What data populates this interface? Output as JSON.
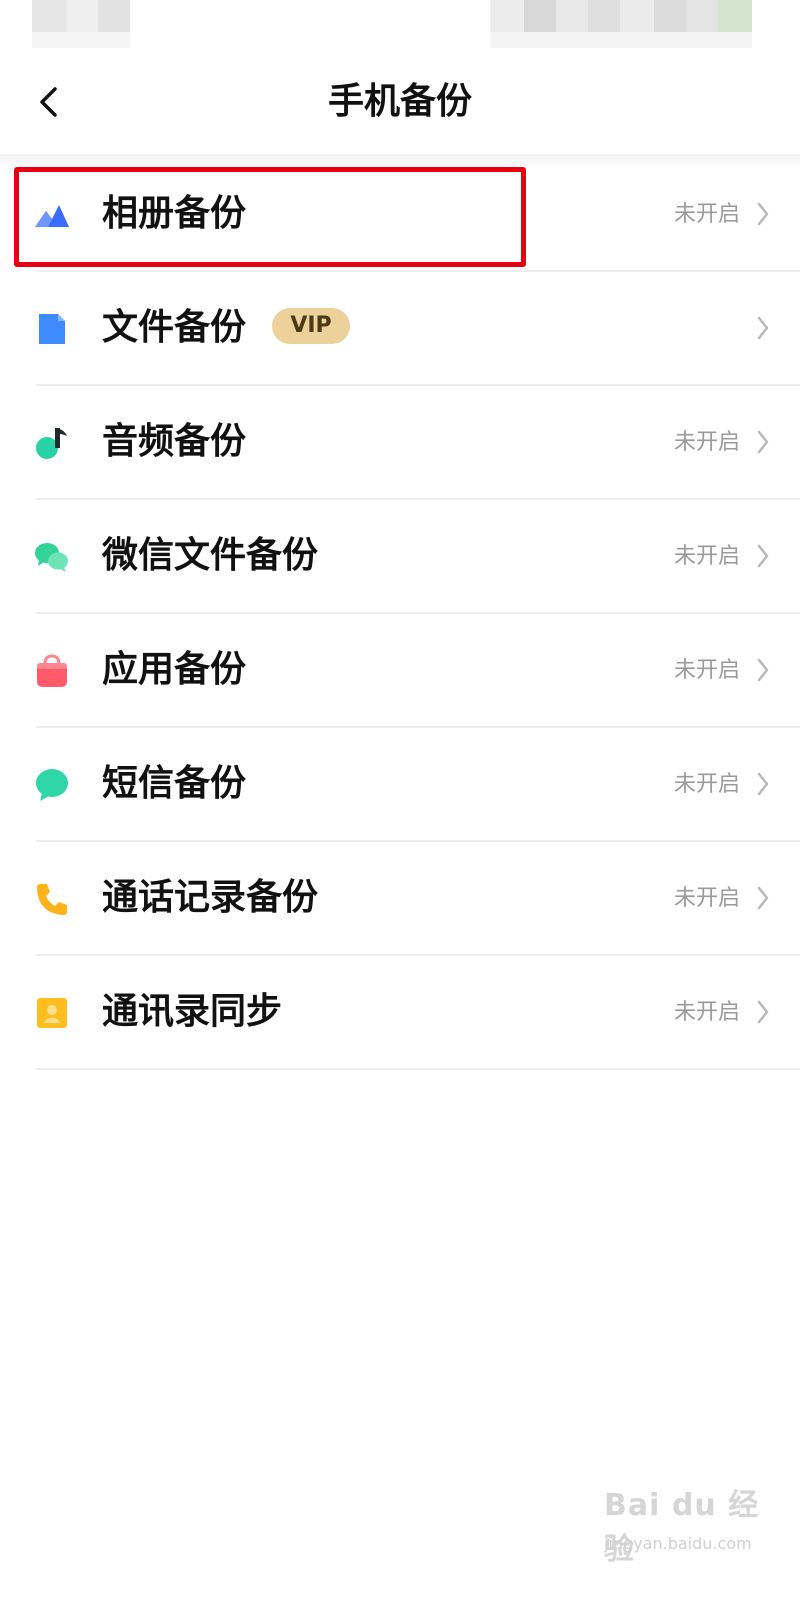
{
  "header": {
    "title": "手机备份"
  },
  "items": [
    {
      "label": "相册备份",
      "status": "未开启",
      "icon": "album-icon",
      "color": "#3b6bff"
    },
    {
      "label": "文件备份",
      "status": "",
      "badge": "VIP",
      "icon": "file-icon",
      "color": "#3d8bff"
    },
    {
      "label": "音频备份",
      "status": "未开启",
      "icon": "music-note-icon",
      "color": "#27d3a4"
    },
    {
      "label": "微信文件备份",
      "status": "未开启",
      "icon": "wechat-icon",
      "color": "#31d39a"
    },
    {
      "label": "应用备份",
      "status": "未开启",
      "icon": "shopping-bag-icon",
      "color": "#ff5b6a"
    },
    {
      "label": "短信备份",
      "status": "未开启",
      "icon": "message-bubble-icon",
      "color": "#2fd7a8"
    },
    {
      "label": "通话记录备份",
      "status": "未开启",
      "icon": "phone-icon",
      "color": "#ffb319"
    },
    {
      "label": "通讯录同步",
      "status": "未开启",
      "icon": "contact-card-icon",
      "color": "#ffbe1f"
    }
  ],
  "colors": {
    "highlight": "#e60012",
    "vip_badge": "#ecd29a",
    "status_text": "#9a9a9a"
  },
  "watermark": {
    "main": "Bai du 经验",
    "sub": "jingyan.baidu.com"
  }
}
